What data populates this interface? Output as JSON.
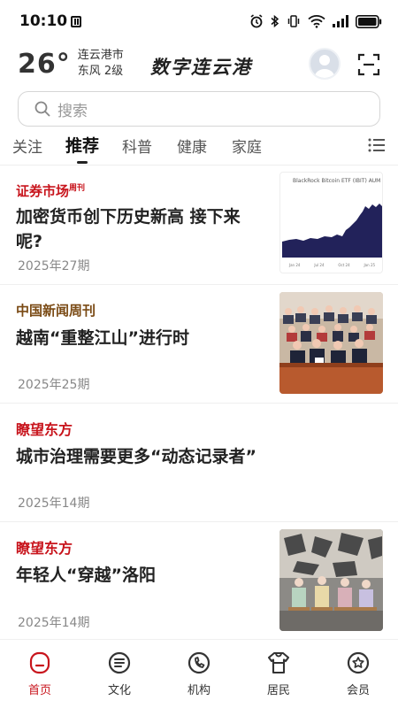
{
  "status_bar": {
    "time": "10:10"
  },
  "header": {
    "temperature": "26°",
    "city": "连云港市",
    "wind": "东风  2级",
    "brand": "数字连云港"
  },
  "search": {
    "placeholder": "搜索"
  },
  "tabs": [
    {
      "label": "关注",
      "active": false
    },
    {
      "label": "推荐",
      "active": true
    },
    {
      "label": "科普",
      "active": false
    },
    {
      "label": "健康",
      "active": false
    },
    {
      "label": "家庭",
      "active": false
    }
  ],
  "articles": [
    {
      "source": "证券市场",
      "source_suffix": "周刊",
      "title_line1": "加密货币创下历史新高 接下来",
      "title_line2": "呢?",
      "date": "2025年27期",
      "thumb_caption": "BlackRock Bitcoin ETF (IBIT) AUM",
      "thumb_axis": [
        "Jan 24",
        "Jul 24",
        "Oct 24",
        "Jan 25"
      ]
    },
    {
      "source": "中国新闻周刊",
      "title_line1": "越南“重整江山”进行时",
      "date": "2025年25期"
    },
    {
      "source": "瞭望东方",
      "title_line1": "城市治理需要更多“动态记录者”",
      "date": "2025年14期"
    },
    {
      "source": "瞭望东方",
      "title_line1": "年轻人“穿越”洛阳",
      "date": "2025年14期"
    }
  ],
  "bottom_nav": [
    {
      "label": "首页",
      "icon": "home-icon",
      "active": true
    },
    {
      "label": "文化",
      "icon": "culture-icon",
      "active": false
    },
    {
      "label": "机构",
      "icon": "institution-icon",
      "active": false
    },
    {
      "label": "居民",
      "icon": "resident-icon",
      "active": false
    },
    {
      "label": "会员",
      "icon": "member-icon",
      "active": false
    }
  ],
  "colors": {
    "accent": "#c8141c",
    "brown_source": "#7a4a14",
    "text": "#222222",
    "muted": "#888888"
  }
}
